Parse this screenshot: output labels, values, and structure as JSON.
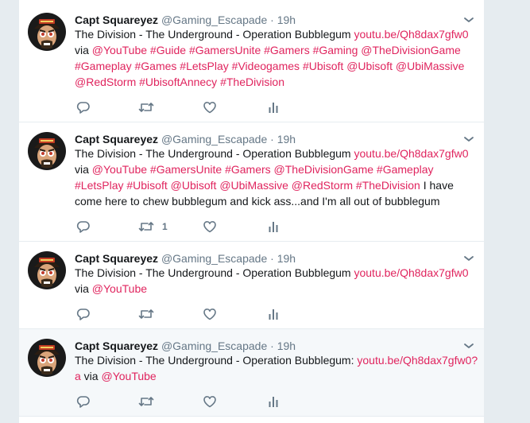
{
  "tweets": [
    {
      "fullname": "Capt Squareyez",
      "handle": "@Gaming_Escapade",
      "dot": "·",
      "time": "19h",
      "segments": [
        {
          "t": "The Division -  The Underground - Operation Bubblegum ",
          "link": false
        },
        {
          "t": "youtu.be/Qh8dax7gfw0",
          "link": true
        },
        {
          "t": " via ",
          "link": false
        },
        {
          "t": "@YouTube",
          "link": true
        },
        {
          "t": " ",
          "link": false
        },
        {
          "t": "#Guide",
          "link": true
        },
        {
          "t": " ",
          "link": false
        },
        {
          "t": "#GamersUnite",
          "link": true
        },
        {
          "t": " ",
          "link": false
        },
        {
          "t": "#Gamers",
          "link": true
        },
        {
          "t": " ",
          "link": false
        },
        {
          "t": "#Gaming",
          "link": true
        },
        {
          "t": " ",
          "link": false
        },
        {
          "t": "@TheDivisionGame",
          "link": true
        },
        {
          "t": " ",
          "link": false
        },
        {
          "t": "#Gameplay",
          "link": true
        },
        {
          "t": " ",
          "link": false
        },
        {
          "t": "#Games",
          "link": true
        },
        {
          "t": " ",
          "link": false
        },
        {
          "t": "#LetsPlay",
          "link": true
        },
        {
          "t": " ",
          "link": false
        },
        {
          "t": "#Videogames",
          "link": true
        },
        {
          "t": " ",
          "link": false
        },
        {
          "t": "#Ubisoft",
          "link": true
        },
        {
          "t": " ",
          "link": false
        },
        {
          "t": "@Ubisoft",
          "link": true
        },
        {
          "t": " ",
          "link": false
        },
        {
          "t": "@UbiMassive",
          "link": true
        },
        {
          "t": " ",
          "link": false
        },
        {
          "t": "@RedStorm",
          "link": true
        },
        {
          "t": " ",
          "link": false
        },
        {
          "t": "#UbisoftAnnecy",
          "link": true
        },
        {
          "t": " ",
          "link": false
        },
        {
          "t": "#TheDivision",
          "link": true
        }
      ],
      "retweet_count": ""
    },
    {
      "fullname": "Capt Squareyez",
      "handle": "@Gaming_Escapade",
      "dot": "·",
      "time": "19h",
      "segments": [
        {
          "t": "The Division -  The Underground - Operation Bubblegum ",
          "link": false
        },
        {
          "t": "youtu.be/Qh8dax7gfw0",
          "link": true
        },
        {
          "t": " via ",
          "link": false
        },
        {
          "t": "@YouTube",
          "link": true
        },
        {
          "t": " ",
          "link": false
        },
        {
          "t": "#GamersUnite",
          "link": true
        },
        {
          "t": " ",
          "link": false
        },
        {
          "t": "#Gamers",
          "link": true
        },
        {
          "t": " ",
          "link": false
        },
        {
          "t": "@TheDivisionGame",
          "link": true
        },
        {
          "t": " ",
          "link": false
        },
        {
          "t": "#Gameplay",
          "link": true
        },
        {
          "t": " ",
          "link": false
        },
        {
          "t": "#LetsPlay",
          "link": true
        },
        {
          "t": " ",
          "link": false
        },
        {
          "t": "#Ubisoft",
          "link": true
        },
        {
          "t": " ",
          "link": false
        },
        {
          "t": "@Ubisoft",
          "link": true
        },
        {
          "t": " ",
          "link": false
        },
        {
          "t": "@UbiMassive",
          "link": true
        },
        {
          "t": " ",
          "link": false
        },
        {
          "t": "@RedStorm",
          "link": true
        },
        {
          "t": " ",
          "link": false
        },
        {
          "t": "#TheDivision",
          "link": true
        },
        {
          "t": " I have come here to chew bubblegum and kick ass...and I'm all out of bubblegum",
          "link": false
        }
      ],
      "retweet_count": "1"
    },
    {
      "fullname": "Capt Squareyez",
      "handle": "@Gaming_Escapade",
      "dot": "·",
      "time": "19h",
      "segments": [
        {
          "t": "The Division -  The Underground - Operation Bubblegum ",
          "link": false
        },
        {
          "t": "youtu.be/Qh8dax7gfw0",
          "link": true
        },
        {
          "t": " via ",
          "link": false
        },
        {
          "t": "@YouTube",
          "link": true
        }
      ],
      "retweet_count": ""
    },
    {
      "fullname": "Capt Squareyez",
      "handle": "@Gaming_Escapade",
      "dot": "·",
      "time": "19h",
      "segments": [
        {
          "t": "The Division - The Underground - Operation Bubblegum: ",
          "link": false
        },
        {
          "t": "youtu.be/Qh8dax7gfw0?a",
          "link": true
        },
        {
          "t": " via ",
          "link": false
        },
        {
          "t": "@YouTube",
          "link": true
        }
      ],
      "retweet_count": ""
    }
  ],
  "icons": {
    "reply": "reply-icon",
    "retweet": "retweet-icon",
    "like": "heart-icon",
    "analytics": "analytics-icon",
    "caret": "chevron-down-icon",
    "avatar": "pirate-avatar"
  },
  "colors": {
    "link": "#e0245e",
    "icon": "#657786",
    "highlight_bg": "#f5f8fa",
    "page_bg": "#e6ecf0"
  }
}
